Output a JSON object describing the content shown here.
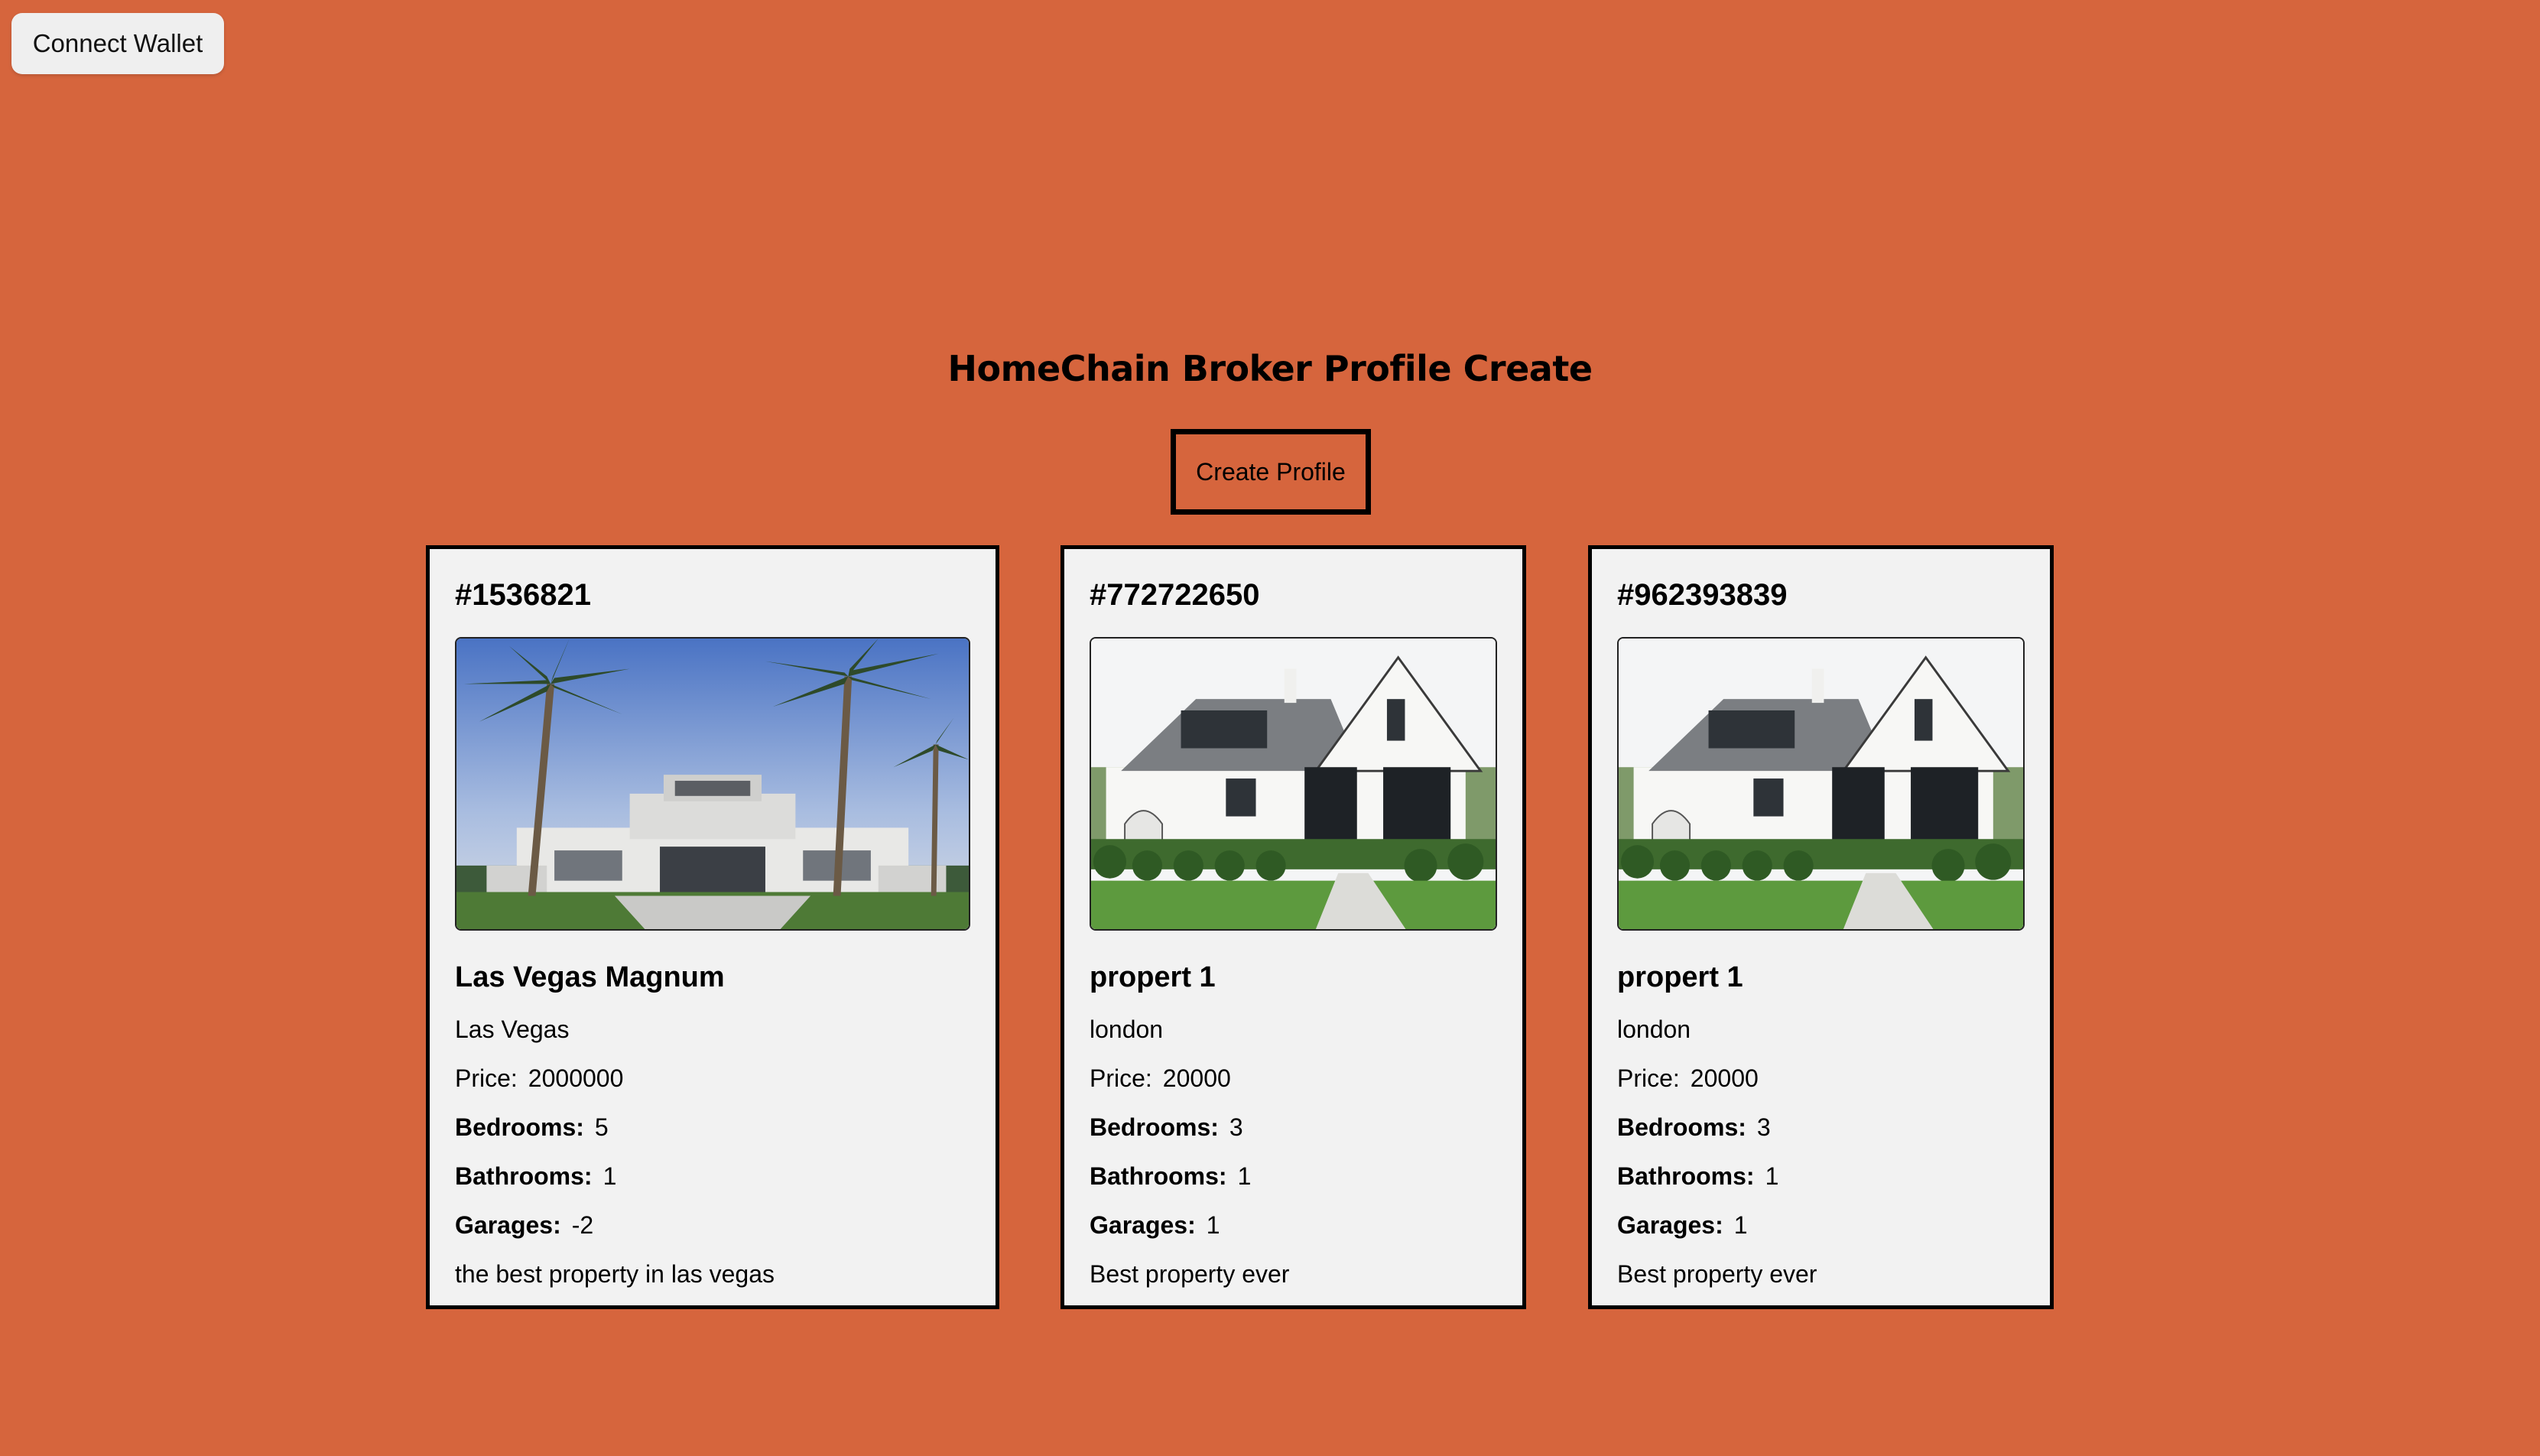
{
  "header": {
    "connect_wallet_label": "Connect Wallet"
  },
  "main": {
    "title": "HomeChain Broker Profile Create",
    "create_profile_label": "Create Profile"
  },
  "labels": {
    "price": "Price:",
    "bedrooms": "Bedrooms:",
    "bathrooms": "Bathrooms:",
    "garages": "Garages:"
  },
  "properties": [
    {
      "id": "#1536821",
      "image_icon": "mansion-with-palm-trees-photo",
      "name": "Las Vegas Magnum",
      "location": "Las Vegas",
      "price": "2000000",
      "bedrooms": "5",
      "bathrooms": "1",
      "garages": "-2",
      "description": "the best property in las vegas"
    },
    {
      "id": "#772722650",
      "image_icon": "white-farmhouse-photo",
      "name": "propert 1",
      "location": "london",
      "price": "20000",
      "bedrooms": "3",
      "bathrooms": "1",
      "garages": "1",
      "description": "Best property ever"
    },
    {
      "id": "#962393839",
      "image_icon": "white-farmhouse-photo",
      "name": "propert 1",
      "location": "london",
      "price": "20000",
      "bedrooms": "3",
      "bathrooms": "1",
      "garages": "1",
      "description": "Best property ever"
    }
  ],
  "colors": {
    "background": "#d6653d",
    "card_background": "#f2f2f2",
    "button_background": "#efefef"
  }
}
